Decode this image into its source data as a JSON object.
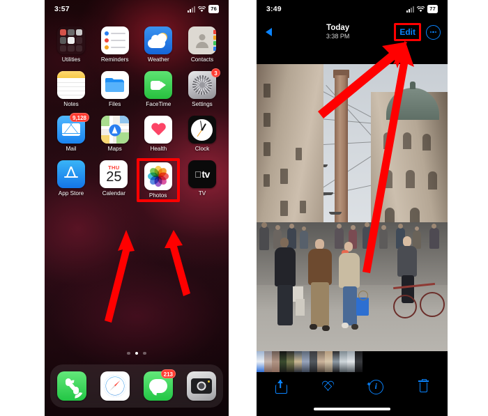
{
  "left_phone": {
    "status_bar": {
      "time": "3:57",
      "battery": "76",
      "signal_icon": "cellular-signal-icon",
      "wifi_icon": "wifi-icon"
    },
    "rows": [
      [
        {
          "label": "Utilities",
          "icon": "utilities-folder-icon",
          "badge": null
        },
        {
          "label": "Reminders",
          "icon": "reminders-app-icon",
          "badge": null
        },
        {
          "label": "Weather",
          "icon": "weather-app-icon",
          "badge": null
        },
        {
          "label": "Contacts",
          "icon": "contacts-app-icon",
          "badge": null
        }
      ],
      [
        {
          "label": "Notes",
          "icon": "notes-app-icon",
          "badge": null
        },
        {
          "label": "Files",
          "icon": "files-app-icon",
          "badge": null
        },
        {
          "label": "FaceTime",
          "icon": "facetime-app-icon",
          "badge": null
        },
        {
          "label": "Settings",
          "icon": "settings-app-icon",
          "badge": "3"
        }
      ],
      [
        {
          "label": "Mail",
          "icon": "mail-app-icon",
          "badge": "9,128"
        },
        {
          "label": "Maps",
          "icon": "maps-app-icon",
          "badge": null
        },
        {
          "label": "Health",
          "icon": "health-app-icon",
          "badge": null
        },
        {
          "label": "Clock",
          "icon": "clock-app-icon",
          "badge": null
        }
      ],
      [
        {
          "label": "App Store",
          "icon": "app-store-app-icon",
          "badge": null
        },
        {
          "label": "Calendar",
          "icon": "calendar-app-icon",
          "badge": null,
          "calendar_dow": "THU",
          "calendar_day": "25"
        },
        {
          "label": "Photos",
          "icon": "photos-app-icon",
          "badge": null,
          "highlighted": true
        },
        {
          "label": "TV",
          "icon": "tv-app-icon",
          "badge": null
        }
      ]
    ],
    "dock": [
      {
        "label": "Phone",
        "icon": "phone-app-icon",
        "badge": null
      },
      {
        "label": "Safari",
        "icon": "safari-app-icon",
        "badge": null
      },
      {
        "label": "Messages",
        "icon": "messages-app-icon",
        "badge": "213"
      },
      {
        "label": "Camera",
        "icon": "camera-app-icon",
        "badge": null
      }
    ],
    "page_dots": {
      "count": 3,
      "active_index": 1
    }
  },
  "right_phone": {
    "status_bar": {
      "time": "3:49",
      "battery": "77",
      "signal_icon": "cellular-signal-icon",
      "wifi_icon": "wifi-icon"
    },
    "nav": {
      "back_icon": "back-chevron-icon",
      "title": "Today",
      "subtitle": "3:38 PM",
      "edit_label": "Edit",
      "more_icon": "more-ellipsis-icon"
    },
    "photo_description": "Bologna street scene with the Asinelli tower and a crowd of pedestrians",
    "toolbar": [
      {
        "name": "share-button",
        "icon": "share-icon"
      },
      {
        "name": "favorite-button",
        "icon": "heart-icon"
      },
      {
        "name": "info-button",
        "icon": "info-icon"
      },
      {
        "name": "delete-button",
        "icon": "trash-icon"
      }
    ],
    "home_indicator": "home-indicator"
  },
  "annotations": {
    "highlight_color": "#ff0000",
    "arrows": [
      {
        "name": "arrow-to-photos-left",
        "target": "Photos app icon"
      },
      {
        "name": "arrow-to-photos-right",
        "target": "Photos app icon"
      },
      {
        "name": "arrow-to-edit-left",
        "target": "Edit button"
      },
      {
        "name": "arrow-to-edit-right",
        "target": "Edit button"
      }
    ]
  }
}
